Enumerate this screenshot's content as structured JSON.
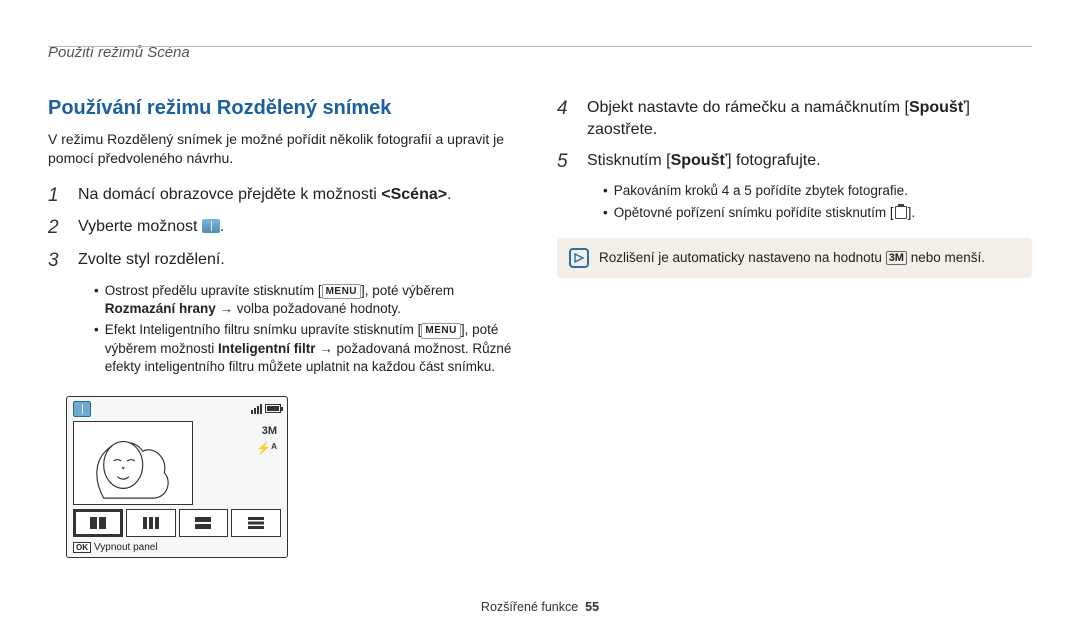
{
  "breadcrumb": "Použití režimů Scéna",
  "section_title": "Používání režimu Rozdělený snímek",
  "intro": "V režimu Rozdělený snímek je možné pořídit několik fotografií a upravit je pomocí předvoleného návrhu.",
  "steps": {
    "s1": {
      "num": "1",
      "text_a": "Na domácí obrazovce přejděte k možnosti ",
      "bold": "<Scéna>",
      "text_b": "."
    },
    "s2": {
      "num": "2",
      "text_a": "Vyberte možnost ",
      "text_b": "."
    },
    "s3": {
      "num": "3",
      "text": "Zvolte styl rozdělení."
    },
    "s4": {
      "num": "4",
      "text_a": "Objekt nastavte do rámečku a namáčknutím [",
      "bold": "Spoušť",
      "text_b": "] zaostřete."
    },
    "s5": {
      "num": "5",
      "text_a": "Stisknutím [",
      "bold": "Spoušť",
      "text_b": "] fotografujte."
    }
  },
  "sub_bullets_left": {
    "b1_a": "Ostrost předělu upravíte stisknutím [",
    "b1_menu": "MENU",
    "b1_b": "], poté výběrem ",
    "b1_bold": "Rozmazání hrany",
    "b1_c": " → volba požadované hodnoty.",
    "b2_a": "Efekt Inteligentního filtru snímku upravíte stisknutím [",
    "b2_menu": "MENU",
    "b2_b": "], poté výběrem možnosti ",
    "b2_bold": "Inteligentní filtr",
    "b2_c": " → požadovaná možnost. Různé efekty inteligentního filtru můžete uplatnit na každou část snímku."
  },
  "sub_bullets_right": {
    "b1": "Pakováním kroků 4 a 5 pořídíte zbytek fotografie.",
    "b2_a": "Opětovné pořízení snímku pořídíte stisknutím [",
    "b2_b": "]."
  },
  "note_text_a": "Rozlišení je automaticky nastaveno na hodnotu ",
  "note_res": "3M",
  "note_text_b": " nebo menší.",
  "preview": {
    "res": "3M",
    "flash": "⚡ᴬ",
    "ok": "OK",
    "footer_label": "Vypnout panel"
  },
  "footer": {
    "section": "Rozšířené funkce",
    "page": "55"
  }
}
